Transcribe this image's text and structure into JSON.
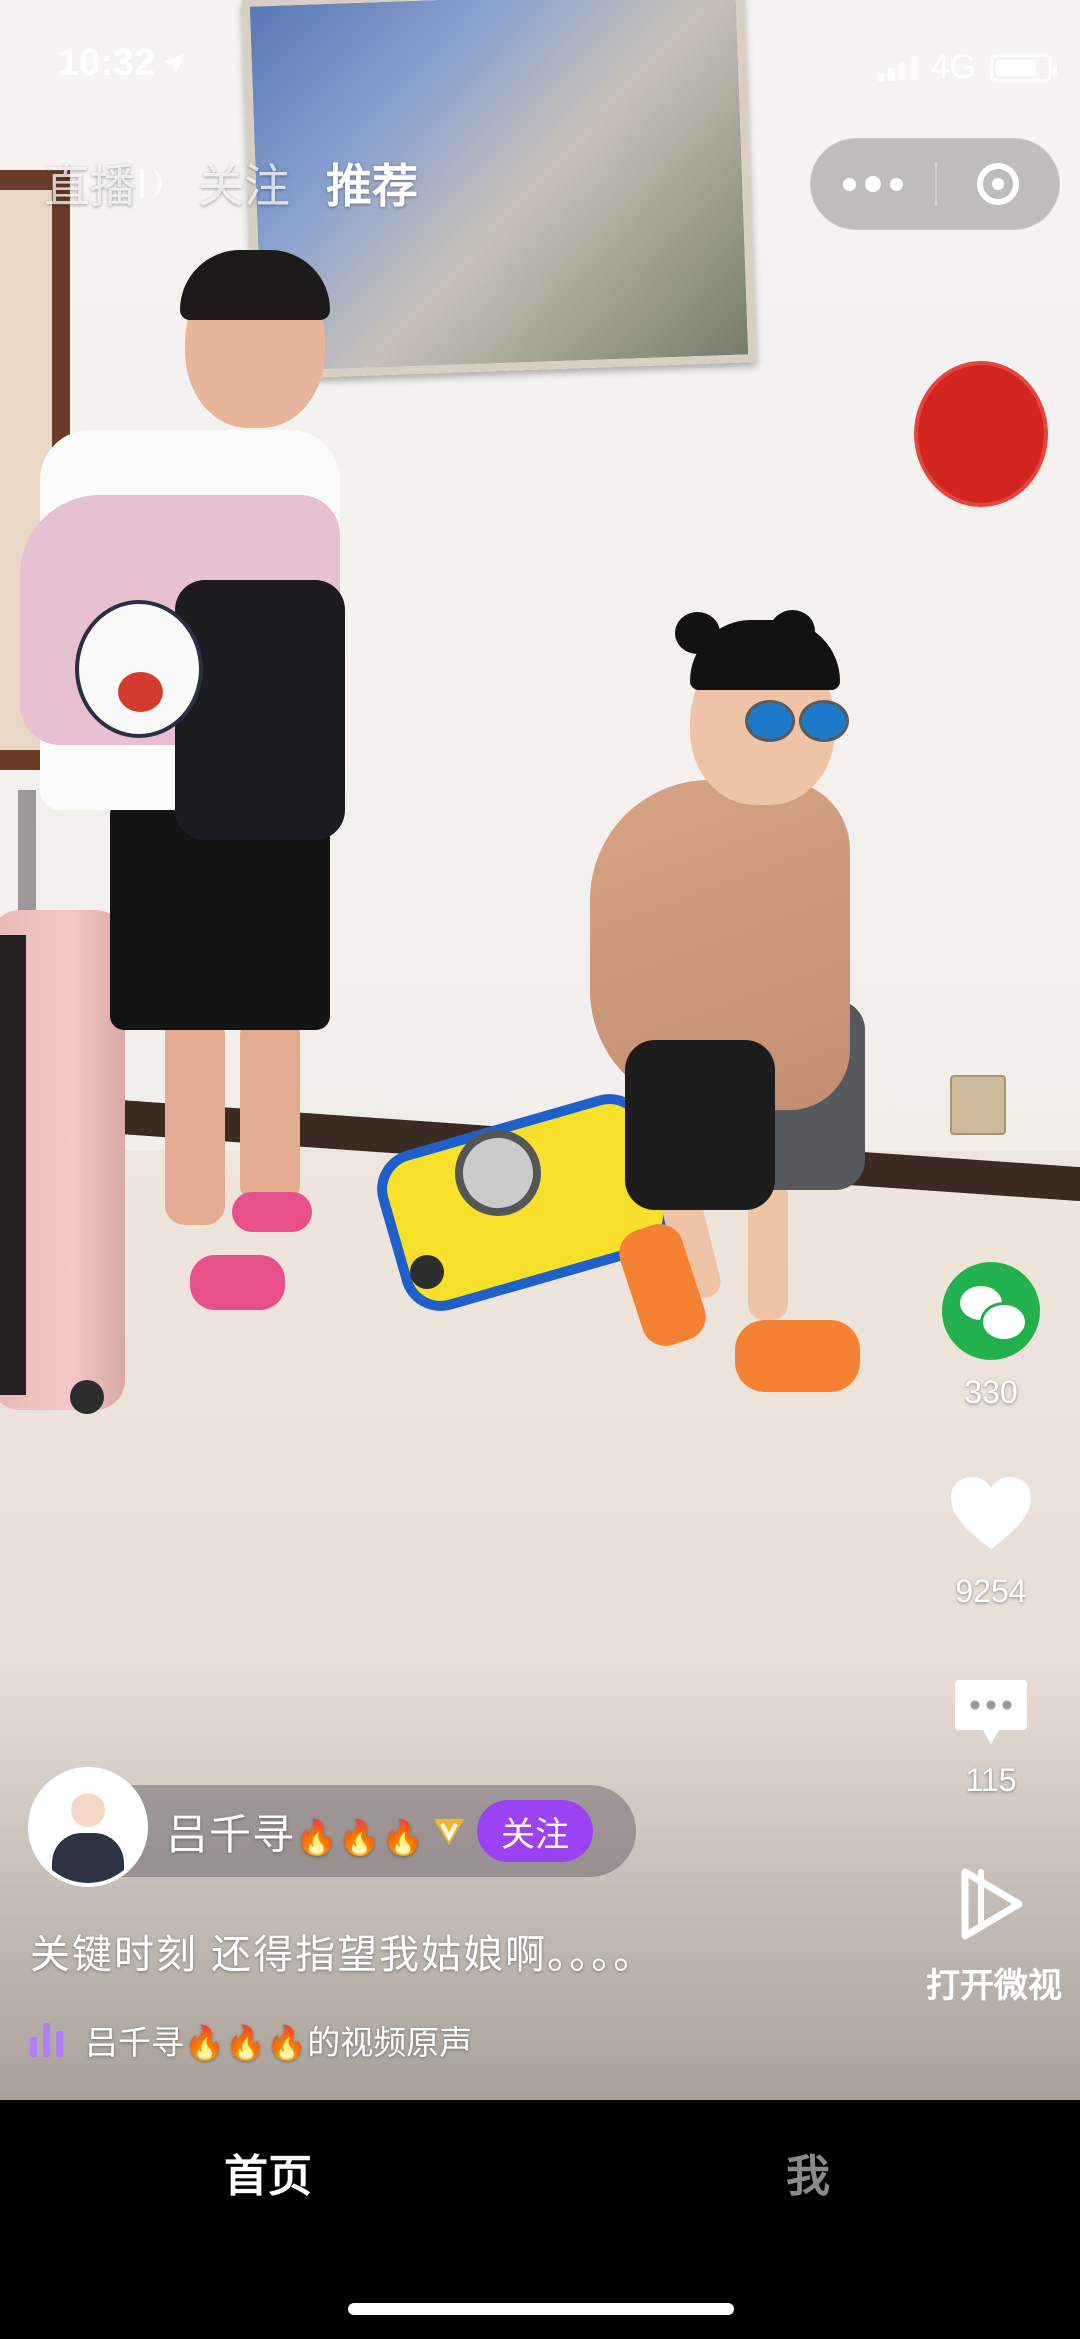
{
  "status_bar": {
    "time": "10:32",
    "network": "4G"
  },
  "top_tabs": [
    {
      "label": "直播",
      "active": false
    },
    {
      "label": "关注",
      "active": false
    },
    {
      "label": "推荐",
      "active": true
    }
  ],
  "capsule": {
    "more_icon": "more-dots-icon",
    "close_icon": "target-icon"
  },
  "actions": {
    "share": {
      "icon": "wechat-icon",
      "count": "330"
    },
    "like": {
      "icon": "heart-icon",
      "count": "9254"
    },
    "comment": {
      "icon": "comment-icon",
      "count": "115"
    },
    "open": {
      "icon": "play-icon",
      "label": "打开微视"
    }
  },
  "author": {
    "name": "吕千寻",
    "fire": "🔥🔥🔥",
    "follow_label": "关注"
  },
  "caption": "关键时刻 还得指望我姑娘啊。。。。",
  "music": {
    "text": "吕千寻🔥🔥🔥的视频原声"
  },
  "bottom_nav": {
    "home": "首页",
    "me": "我"
  },
  "colors": {
    "follow": "#9b42f5",
    "wechat": "#23b14d",
    "music_bars": "#b27cff"
  }
}
